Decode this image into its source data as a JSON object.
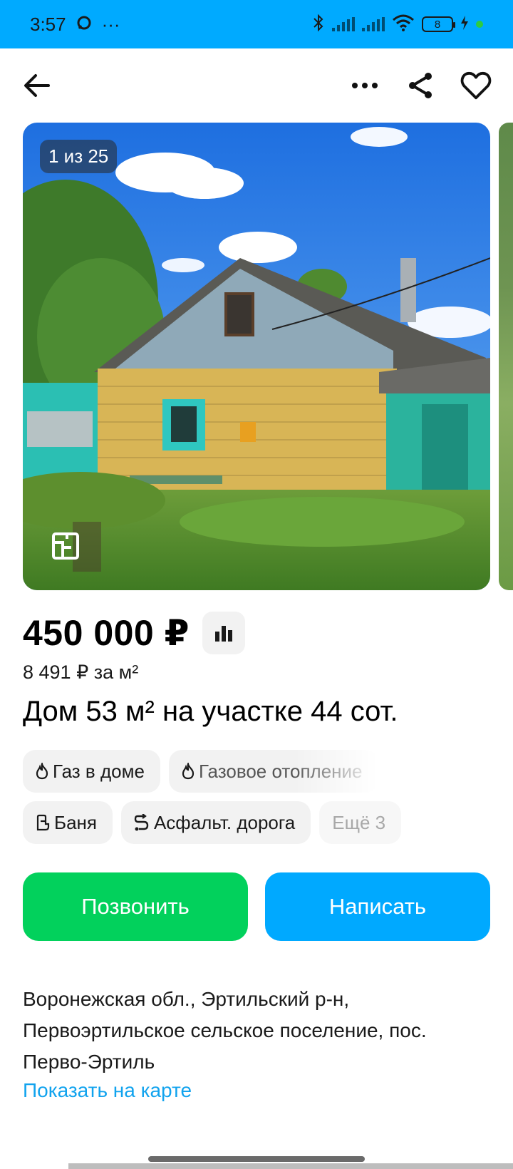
{
  "status_bar": {
    "time": "3:57",
    "more": "···",
    "battery": "8"
  },
  "toolbar": {
    "back": "back-arrow-icon",
    "more": "more-dots-icon",
    "share": "share-icon",
    "favorite": "heart-icon"
  },
  "gallery": {
    "counter": "1 из 25",
    "plan_icon": "floor-plan-icon"
  },
  "listing": {
    "price": "450 000 ₽",
    "price_per_m": "8 491 ₽ за м²",
    "title": "Дом 53 м² на участке 44 сот."
  },
  "features": [
    {
      "label": "Газ в доме",
      "icon": "flame-icon"
    },
    {
      "label": "Газовое отопление",
      "icon": "flame-icon"
    },
    {
      "label": "Баня",
      "icon": "bath-icon"
    },
    {
      "label": "Асфальт. дорога",
      "icon": "road-icon"
    },
    {
      "label": "Ещё 3"
    }
  ],
  "actions": {
    "call": "Позвонить",
    "write": "Написать"
  },
  "address": {
    "line1": "Воронежская обл., Эртильский р-н,",
    "line2": "Первоэртильское сельское поселение, пос.",
    "line3": "Перво-Эртиль",
    "map_link": "Показать на карте"
  },
  "colors": {
    "status_bar": "#00aaff",
    "call_button": "#02d15c",
    "write_button": "#00a9ff",
    "link": "#11a3ee"
  }
}
